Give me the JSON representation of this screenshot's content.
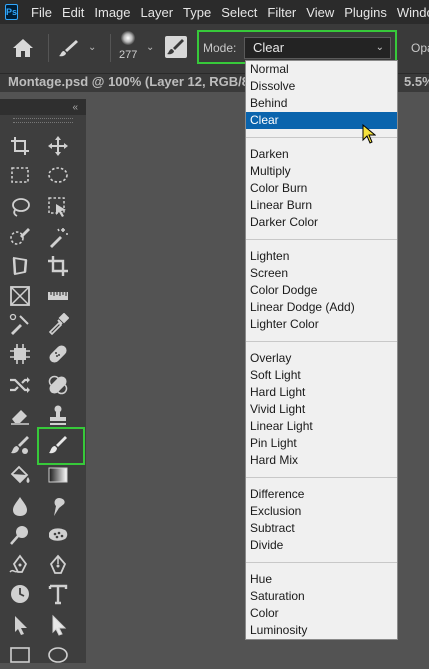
{
  "menubar": {
    "logo": "Ps",
    "items": [
      "File",
      "Edit",
      "Image",
      "Layer",
      "Type",
      "Select",
      "Filter",
      "View",
      "Plugins",
      "Window"
    ]
  },
  "options": {
    "brush_size": "277",
    "mode_label": "Mode:",
    "mode_value": "Clear",
    "opacity_label": "Opa"
  },
  "document": {
    "tab_title": "Montage.psd @ 100% (Layer 12, RGB/8",
    "zoom_fragment": "5.5%"
  },
  "blend_modes": {
    "selected": "Clear",
    "groups": [
      [
        "Normal",
        "Dissolve",
        "Behind",
        "Clear"
      ],
      [
        "Darken",
        "Multiply",
        "Color Burn",
        "Linear Burn",
        "Darker Color"
      ],
      [
        "Lighten",
        "Screen",
        "Color Dodge",
        "Linear Dodge (Add)",
        "Lighter Color"
      ],
      [
        "Overlay",
        "Soft Light",
        "Hard Light",
        "Vivid Light",
        "Linear Light",
        "Pin Light",
        "Hard Mix"
      ],
      [
        "Difference",
        "Exclusion",
        "Subtract",
        "Divide"
      ],
      [
        "Hue",
        "Saturation",
        "Color",
        "Luminosity"
      ]
    ]
  },
  "tools": [
    "artboard-icon",
    "move-icon",
    "rect-marquee-icon",
    "ellipse-marquee-icon",
    "lasso-icon",
    "object-select-icon",
    "quick-select-icon",
    "magic-wand-icon",
    "perspective-crop-icon",
    "crop-icon",
    "frame-icon",
    "ruler-icon",
    "color-sampler-icon",
    "eyedropper-icon",
    "content-aware-icon",
    "bandage-icon",
    "content-move-icon",
    "patch-icon",
    "eraser-icon",
    "clone-stamp-icon",
    "mixer-brush-icon",
    "brush-icon",
    "paint-bucket-icon",
    "gradient-icon",
    "blur-icon",
    "smudge-icon",
    "dodge-icon",
    "sponge-icon",
    "freeform-pen-icon",
    "pen-icon",
    "history-brush-icon",
    "type-icon",
    "path-select-icon",
    "direct-select-icon",
    "rectangle-shape-icon",
    "ellipse-shape-icon"
  ],
  "colors": {
    "selection": "#0a64ad",
    "highlight_box": "#37c93a"
  }
}
